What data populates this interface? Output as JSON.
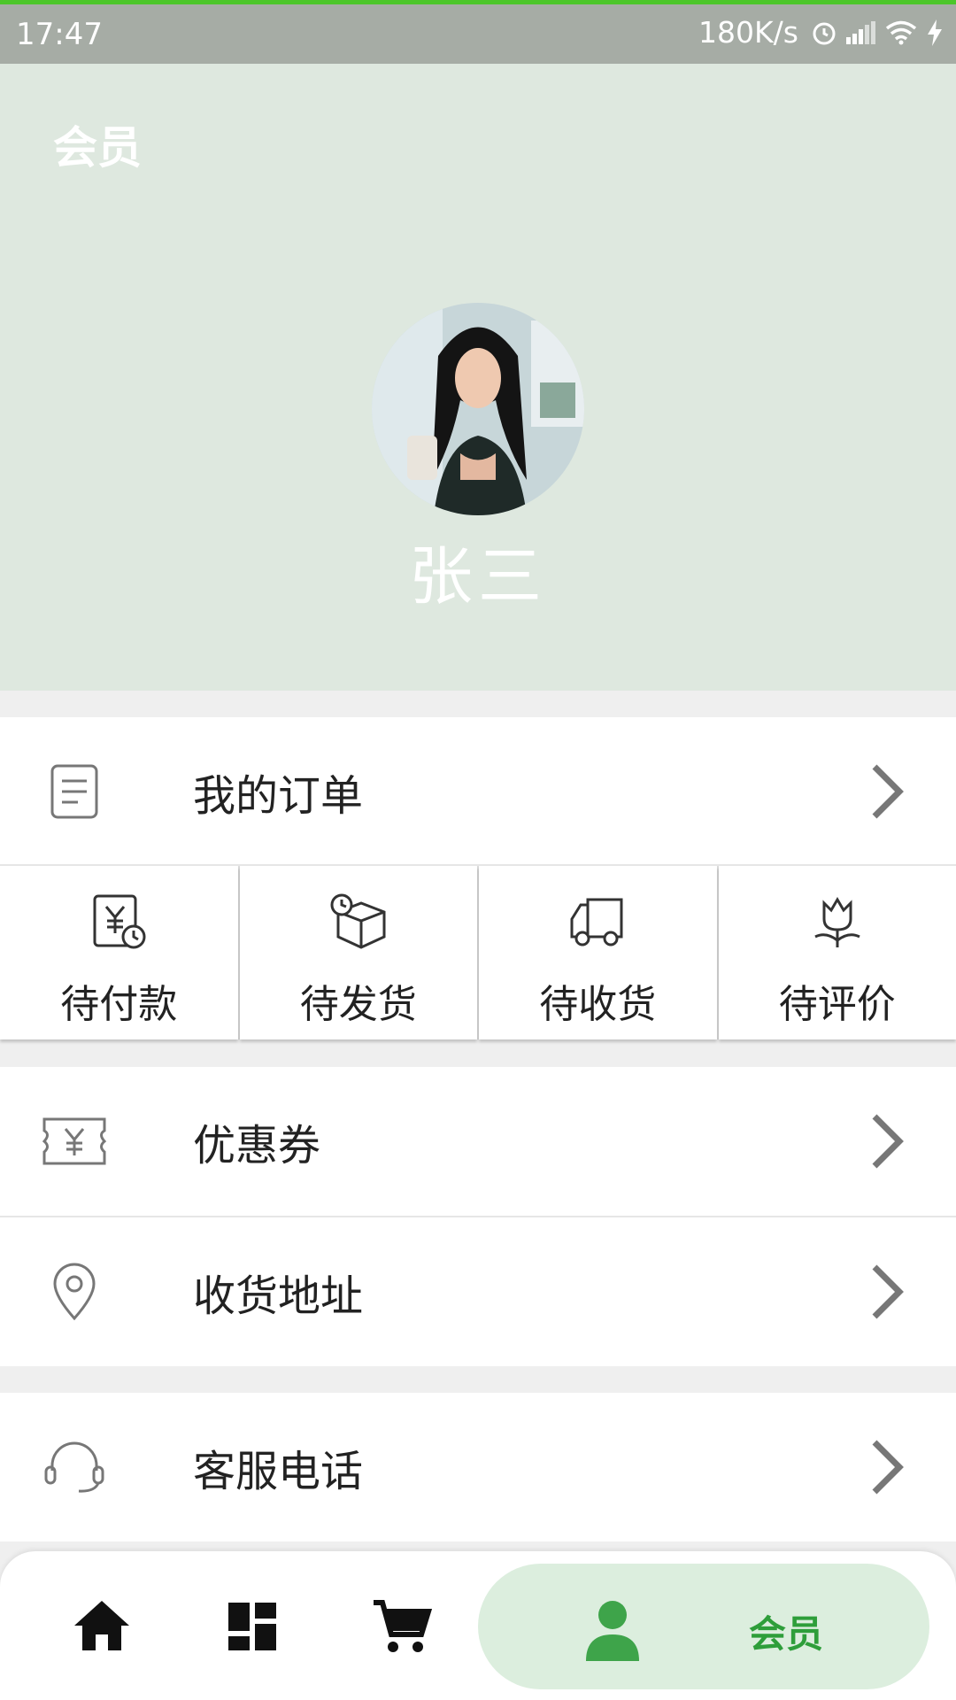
{
  "status_bar": {
    "time": "17:47",
    "speed": "180K/s"
  },
  "header": {
    "title": "会员",
    "username": "张三",
    "background": "#dee8df"
  },
  "menu": {
    "my_orders": "我的订单",
    "coupons": "优惠券",
    "address": "收货地址",
    "service_phone": "客服电话"
  },
  "order_status": [
    {
      "label": "待付款",
      "icon": "yuan-clock-icon"
    },
    {
      "label": "待发货",
      "icon": "box-clock-icon"
    },
    {
      "label": "待收货",
      "icon": "truck-icon"
    },
    {
      "label": "待评价",
      "icon": "flower-icon"
    }
  ],
  "bottom_nav": {
    "active_label": "会员",
    "accent": "#2e9e3a",
    "active_bg": "#dceede"
  }
}
